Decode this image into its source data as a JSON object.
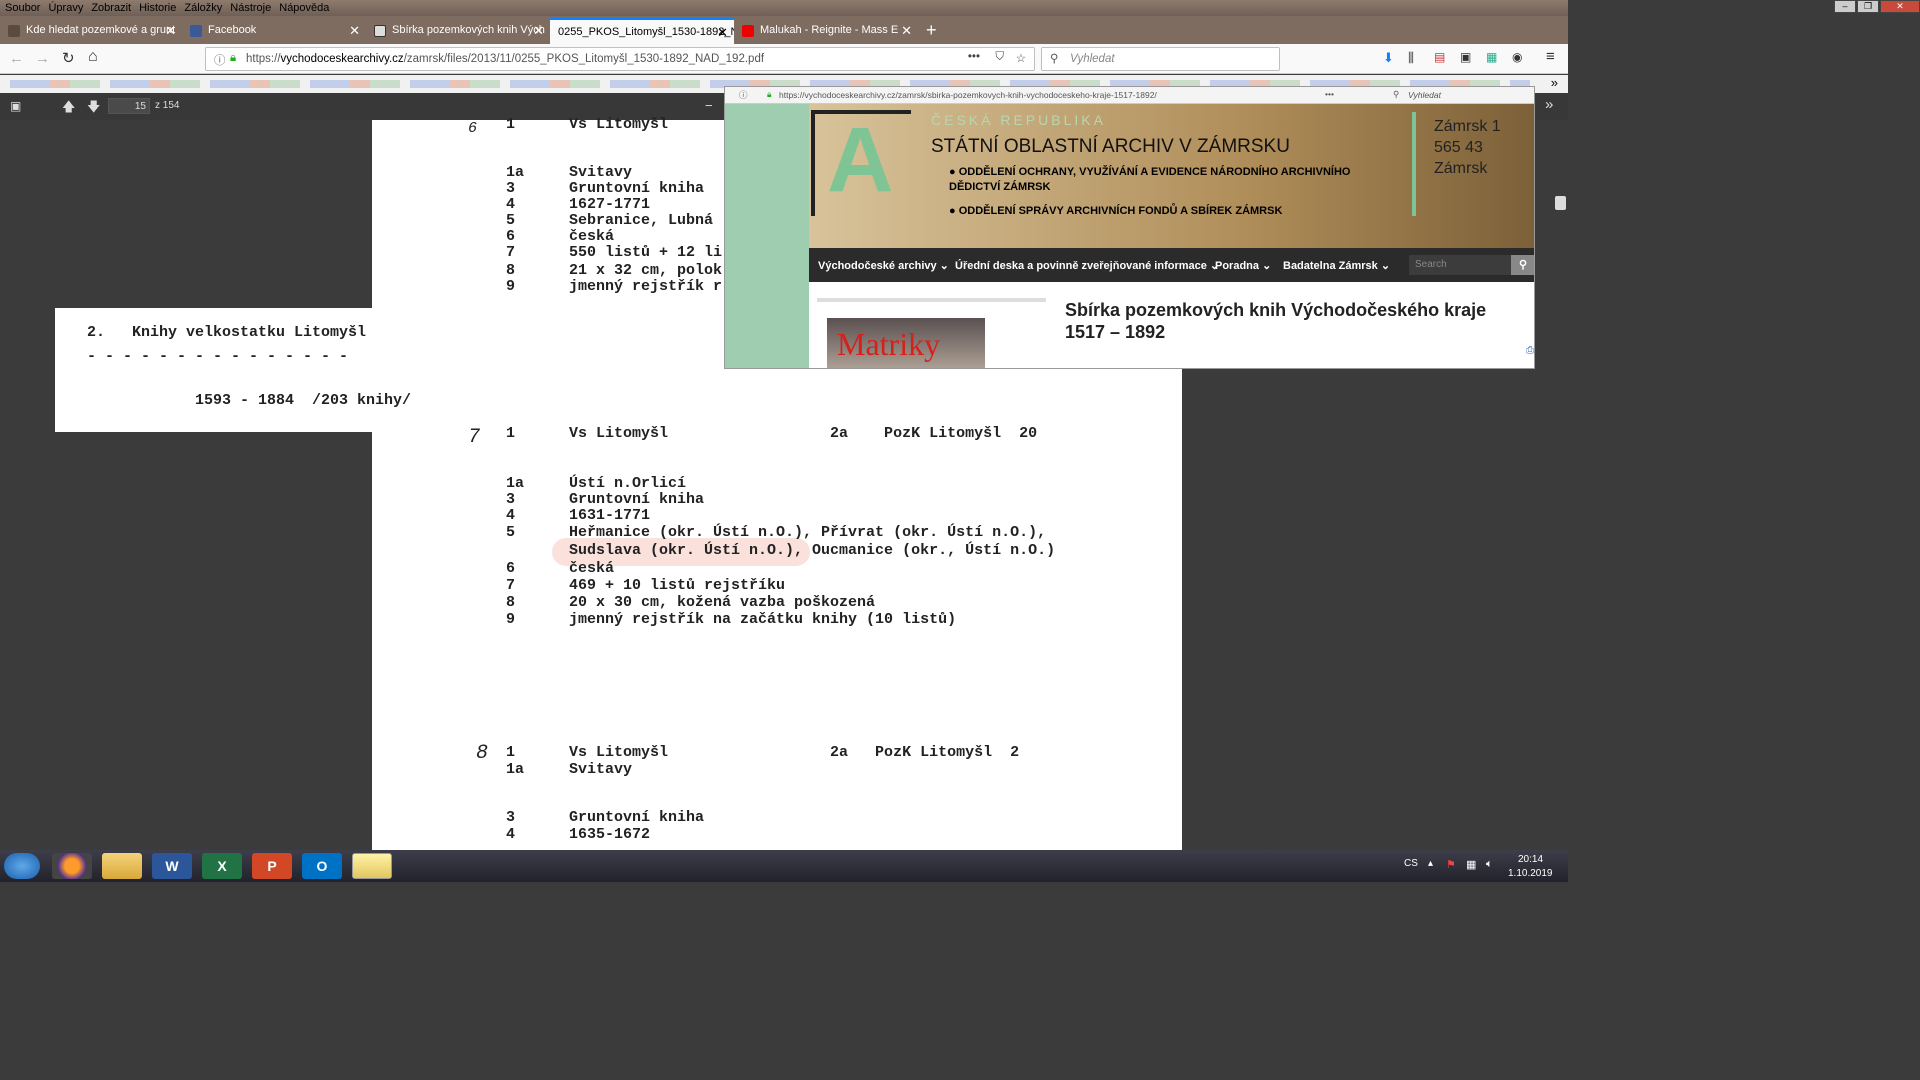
{
  "menubar": {
    "items": [
      "Soubor",
      "Úpravy",
      "Zobrazit",
      "Historie",
      "Záložky",
      "Nástroje",
      "Nápověda"
    ]
  },
  "tabs": [
    {
      "label": "Kde hledat pozemkové a grunt",
      "icon": "page-icon",
      "color": "#5a4a40"
    },
    {
      "label": "Facebook",
      "icon": "facebook-icon",
      "color": "#3b5998"
    },
    {
      "label": "Sbírka pozemkových knih Vých",
      "icon": "archive-icon",
      "color": "#333"
    },
    {
      "label": "0255_PKOS_Litomyšl_1530-1892_N",
      "icon": "",
      "color": "",
      "active": true
    },
    {
      "label": "Malukah - Reignite - Mass E",
      "icon": "youtube-icon",
      "color": "#e00"
    }
  ],
  "url": {
    "prefix": "https://",
    "domain": "vychodoceskearchivy.cz",
    "path": "/zamrsk/files/2013/11/0255_PKOS_Litomyšl_1530-1892_NAD_192.pdf"
  },
  "search": {
    "placeholder": "Vyhledat"
  },
  "pdf": {
    "page": "15",
    "total": "z 154"
  },
  "overlay_text": {
    "title": "2.   Knihy velkostatku Litomyšl",
    "dashes": "- - - - - - - - - - - - - - -",
    "range": "1593 - 1884  /203 knihy/"
  },
  "doc": {
    "top_mark": "6",
    "top_line": "1      Vs Litomyšl",
    "block1": [
      "1a     Svitavy",
      "3      Gruntovní kniha",
      "4      1627-1771",
      "5      Sebranice, Lubná",
      "6      česká",
      "7      550 listů + 12 li",
      "8      21 x 32 cm, polok",
      "9      jmenný rejstřík r"
    ],
    "entry7_mark": "7",
    "entry7_head": "1      Vs Litomyšl                  2a    PozK Litomyšl  20",
    "entry7": [
      "1a     Ústí n.Orlicí",
      "3      Gruntovní kniha",
      "4      1631-1771",
      "5      Heřmanice (okr. Ústí n.O.), Přívrat (okr. Ústí n.O.),",
      "       Sudslava (okr. Ústí n.O.), Oucmanice (okr., Ústí n.O.)",
      "6      česká",
      "7      469 + 10 listů rejstříku",
      "8      20 x 30 cm, kožená vazba poškozená",
      "9      jmenný rejstřík na začátku knihy (10 listů)"
    ],
    "entry8_mark": "8",
    "entry8_head": "1      Vs Litomyšl                  2a   PozK Litomyšl  2",
    "entry8": [
      "1a     Svitavy",
      "",
      "",
      "3      Gruntovní kniha",
      "4      1635-1672"
    ]
  },
  "site": {
    "url": "https://vychodoceskearchivy.cz/zamrsk/sbirka-pozemkovych-knih-vychodoceskeho-kraje-1517-1892/",
    "search_placeholder": "Vyhledat",
    "letter": "A",
    "country": "ČESKÁ REPUBLIKA",
    "archive": "STÁTNÍ OBLASTNÍ ARCHIV V ZÁMRSKU",
    "dept1": "ODDĚLENÍ OCHRANY, VYUŽÍVÁNÍ A EVIDENCE NÁRODNÍHO ARCHIVNÍHO DĚDICTVÍ ZÁMRSK",
    "dept2": "ODDĚLENÍ SPRÁVY ARCHIVNÍCH FONDŮ A SBÍREK ZÁMRSK",
    "address": [
      "Zámrsk 1",
      "565 43",
      "Zámrsk"
    ],
    "nav": [
      "Východočeské archivy ⌄",
      "Úřední deska a povinně zveřejňované informace ⌄",
      "Poradna ⌄",
      "Badatelna Zámrsk ⌄"
    ],
    "nav_search": "Search",
    "heading": "Sbírka pozemkových knih Východočeského kraje 1517 – 1892",
    "thumb_label": "Matriky"
  },
  "taskbar": {
    "lang": "CS",
    "time": "20:14",
    "date": "1.10.2019"
  }
}
